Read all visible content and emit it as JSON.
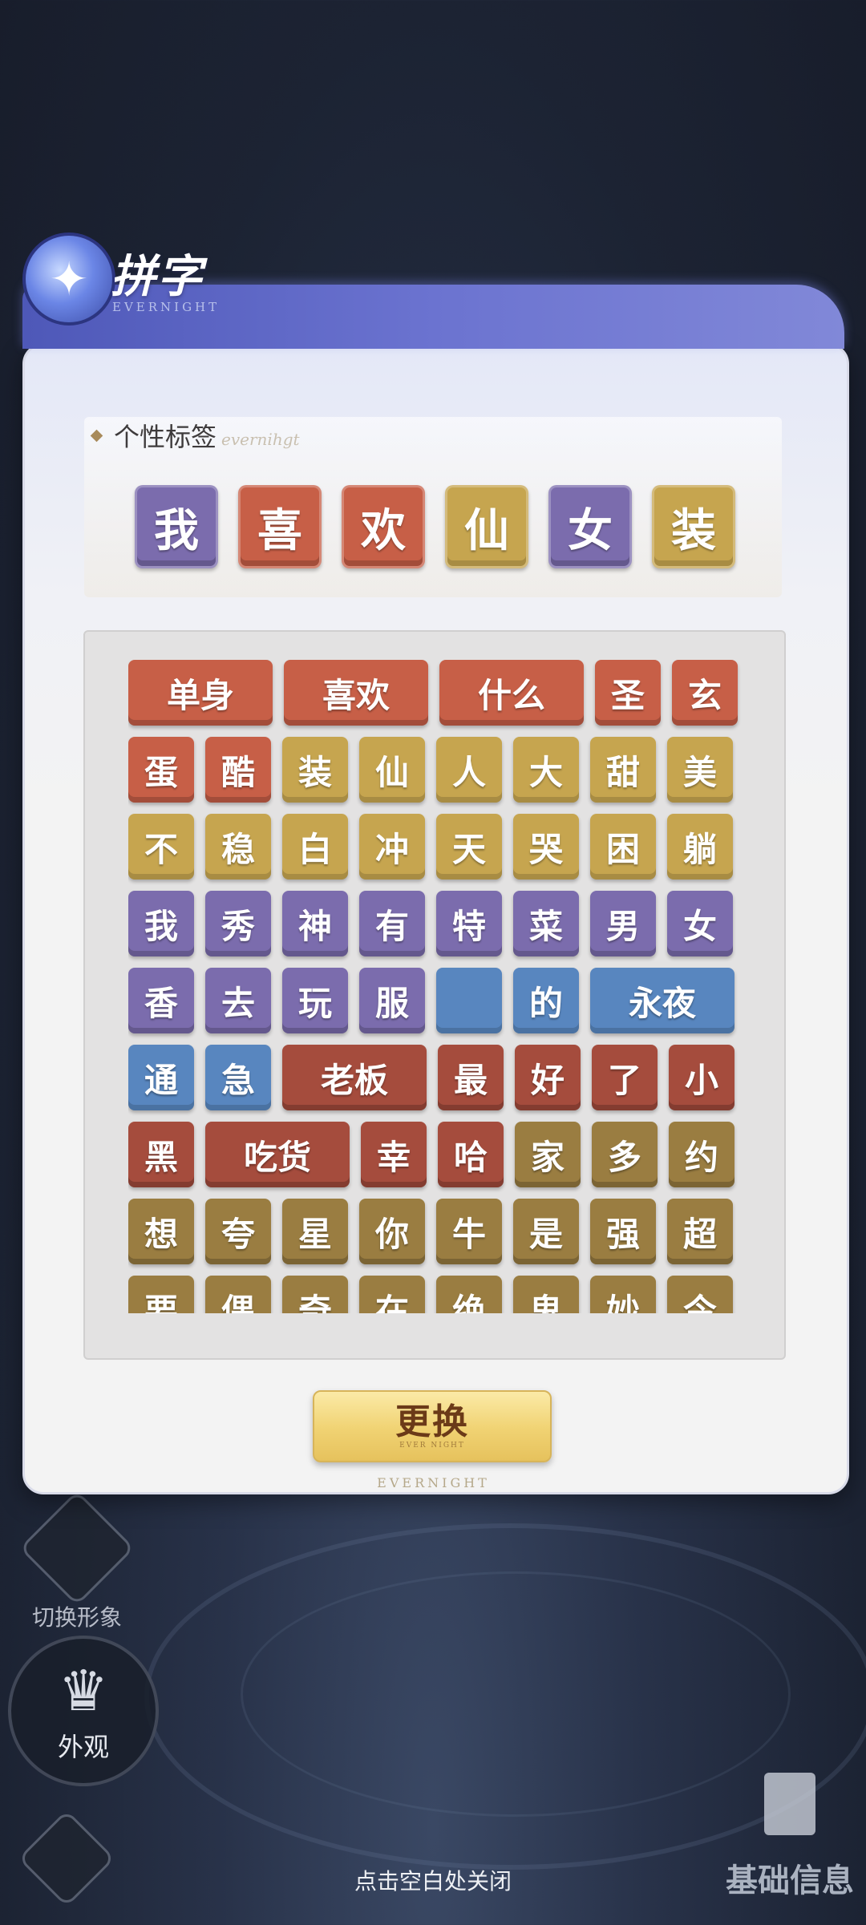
{
  "panel": {
    "title": "拼字",
    "subtitle": "EVERNIGHT",
    "footer": "EVERNIGHT"
  },
  "tag_section": {
    "title": "个性标签",
    "deco": "evernihgt",
    "tiles": [
      {
        "char": "我",
        "color": "purple"
      },
      {
        "char": "喜",
        "color": "red"
      },
      {
        "char": "欢",
        "color": "red"
      },
      {
        "char": "仙",
        "color": "gold"
      },
      {
        "char": "女",
        "color": "purple"
      },
      {
        "char": "装",
        "color": "gold"
      }
    ]
  },
  "grid": [
    [
      {
        "t": "单身",
        "c": "red",
        "w": 2
      },
      {
        "t": "喜欢",
        "c": "red",
        "w": 2
      },
      {
        "t": "什么",
        "c": "red",
        "w": 2
      },
      {
        "t": "圣",
        "c": "red",
        "w": 1
      },
      {
        "t": "玄",
        "c": "red",
        "w": 1
      }
    ],
    [
      {
        "t": "蛋",
        "c": "red",
        "w": 1
      },
      {
        "t": "酷",
        "c": "red",
        "w": 1
      },
      {
        "t": "装",
        "c": "gold",
        "w": 1
      },
      {
        "t": "仙",
        "c": "gold",
        "w": 1
      },
      {
        "t": "人",
        "c": "gold",
        "w": 1
      },
      {
        "t": "大",
        "c": "gold",
        "w": 1
      },
      {
        "t": "甜",
        "c": "gold",
        "w": 1
      },
      {
        "t": "美",
        "c": "gold",
        "w": 1
      }
    ],
    [
      {
        "t": "不",
        "c": "gold",
        "w": 1
      },
      {
        "t": "稳",
        "c": "gold",
        "w": 1
      },
      {
        "t": "白",
        "c": "gold",
        "w": 1
      },
      {
        "t": "冲",
        "c": "gold",
        "w": 1
      },
      {
        "t": "天",
        "c": "gold",
        "w": 1
      },
      {
        "t": "哭",
        "c": "gold",
        "w": 1
      },
      {
        "t": "困",
        "c": "gold",
        "w": 1
      },
      {
        "t": "躺",
        "c": "gold",
        "w": 1
      }
    ],
    [
      {
        "t": "我",
        "c": "purple",
        "w": 1
      },
      {
        "t": "秀",
        "c": "purple",
        "w": 1
      },
      {
        "t": "神",
        "c": "purple",
        "w": 1
      },
      {
        "t": "有",
        "c": "purple",
        "w": 1
      },
      {
        "t": "特",
        "c": "purple",
        "w": 1
      },
      {
        "t": "菜",
        "c": "purple",
        "w": 1
      },
      {
        "t": "男",
        "c": "purple",
        "w": 1
      },
      {
        "t": "女",
        "c": "purple",
        "w": 1
      }
    ],
    [
      {
        "t": "香",
        "c": "purple",
        "w": 1
      },
      {
        "t": "去",
        "c": "purple",
        "w": 1
      },
      {
        "t": "玩",
        "c": "purple",
        "w": 1
      },
      {
        "t": "服",
        "c": "purple",
        "w": 1
      },
      {
        "t": "",
        "c": "blue",
        "w": 1
      },
      {
        "t": "的",
        "c": "blue",
        "w": 1
      },
      {
        "t": "永夜",
        "c": "blue",
        "w": 2
      }
    ],
    [
      {
        "t": "通",
        "c": "blue",
        "w": 1
      },
      {
        "t": "急",
        "c": "blue",
        "w": 1
      },
      {
        "t": "老板",
        "c": "brick",
        "w": 2
      },
      {
        "t": "最",
        "c": "brick",
        "w": 1
      },
      {
        "t": "好",
        "c": "brick",
        "w": 1
      },
      {
        "t": "了",
        "c": "brick",
        "w": 1
      },
      {
        "t": "小",
        "c": "brick",
        "w": 1
      }
    ],
    [
      {
        "t": "黑",
        "c": "brick",
        "w": 1
      },
      {
        "t": "吃货",
        "c": "brick",
        "w": 2
      },
      {
        "t": "幸",
        "c": "brick",
        "w": 1
      },
      {
        "t": "哈",
        "c": "brick",
        "w": 1
      },
      {
        "t": "家",
        "c": "olive",
        "w": 1
      },
      {
        "t": "多",
        "c": "olive",
        "w": 1
      },
      {
        "t": "约",
        "c": "olive",
        "w": 1
      }
    ],
    [
      {
        "t": "想",
        "c": "olive",
        "w": 1
      },
      {
        "t": "夸",
        "c": "olive",
        "w": 1
      },
      {
        "t": "星",
        "c": "olive",
        "w": 1
      },
      {
        "t": "你",
        "c": "olive",
        "w": 1
      },
      {
        "t": "牛",
        "c": "olive",
        "w": 1
      },
      {
        "t": "是",
        "c": "olive",
        "w": 1
      },
      {
        "t": "强",
        "c": "olive",
        "w": 1
      },
      {
        "t": "超",
        "c": "olive",
        "w": 1
      }
    ],
    [
      {
        "t": "要",
        "c": "olive",
        "w": 1
      },
      {
        "t": "偶",
        "c": "olive",
        "w": 1
      },
      {
        "t": "奇",
        "c": "olive",
        "w": 1
      },
      {
        "t": "在",
        "c": "olive",
        "w": 1
      },
      {
        "t": "绝",
        "c": "olive",
        "w": 1
      },
      {
        "t": "鬼",
        "c": "olive",
        "w": 1
      },
      {
        "t": "妙",
        "c": "olive",
        "w": 1
      },
      {
        "t": "今",
        "c": "olive",
        "w": 1
      }
    ]
  ],
  "change_button": {
    "label": "更换",
    "sub": "EVER NIGHT"
  },
  "side": {
    "switch_label": "切换形象",
    "appearance_label": "外观",
    "base_info_label": "基础信息"
  },
  "close_hint": "点击空白处关闭"
}
